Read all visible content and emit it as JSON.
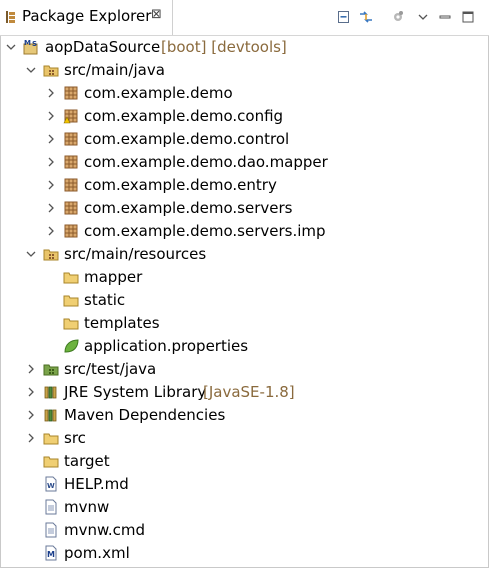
{
  "view": {
    "title": "Package Explorer",
    "close_glyph": "⊠"
  },
  "toolbar": {
    "icons": [
      "collapse-all-icon",
      "link-with-editor-icon",
      "view-menu-gear-icon",
      "view-menu-chevron-icon",
      "minimize-icon",
      "maximize-icon"
    ]
  },
  "tree": {
    "project": {
      "name": "aopDataSource",
      "decoration": "[boot] [devtools]",
      "expanded": true,
      "icon": "maven-spring-project-icon"
    },
    "src_main_java": {
      "name": "src/main/java",
      "expanded": true,
      "icon": "source-folder-icon"
    },
    "packages": [
      {
        "name": "com.example.demo",
        "icon": "package-icon"
      },
      {
        "name": "com.example.demo.config",
        "icon": "package-warning-icon"
      },
      {
        "name": "com.example.demo.control",
        "icon": "package-icon"
      },
      {
        "name": "com.example.demo.dao.mapper",
        "icon": "package-icon"
      },
      {
        "name": "com.example.demo.entry",
        "icon": "package-icon"
      },
      {
        "name": "com.example.demo.servers",
        "icon": "package-icon"
      },
      {
        "name": "com.example.demo.servers.imp",
        "icon": "package-icon"
      }
    ],
    "src_main_resources": {
      "name": "src/main/resources",
      "expanded": true,
      "icon": "resource-folder-icon"
    },
    "resources": [
      {
        "name": "mapper",
        "icon": "folder-icon"
      },
      {
        "name": "static",
        "icon": "folder-icon"
      },
      {
        "name": "templates",
        "icon": "folder-icon"
      },
      {
        "name": "application.properties",
        "icon": "spring-properties-icon"
      }
    ],
    "src_test_java": {
      "name": "src/test/java",
      "expanded": false,
      "icon": "test-source-folder-icon"
    },
    "jre": {
      "name": "JRE System Library",
      "decoration": "[JavaSE-1.8]",
      "expanded": false,
      "icon": "library-icon"
    },
    "maven": {
      "name": "Maven Dependencies",
      "expanded": false,
      "icon": "library-icon"
    },
    "src": {
      "name": "src",
      "expanded": false,
      "icon": "folder-icon"
    },
    "files": [
      {
        "name": "target",
        "icon": "folder-icon"
      },
      {
        "name": "HELP.md",
        "icon": "markdown-file-icon"
      },
      {
        "name": "mvnw",
        "icon": "text-file-icon"
      },
      {
        "name": "mvnw.cmd",
        "icon": "text-file-icon"
      },
      {
        "name": "pom.xml",
        "icon": "maven-pom-icon"
      }
    ]
  },
  "colors": {
    "decoration": "#8a6a3d",
    "package_brown": "#8b5a2b",
    "folder_yellow": "#e9c46a",
    "tree_twistie": "#555555"
  }
}
